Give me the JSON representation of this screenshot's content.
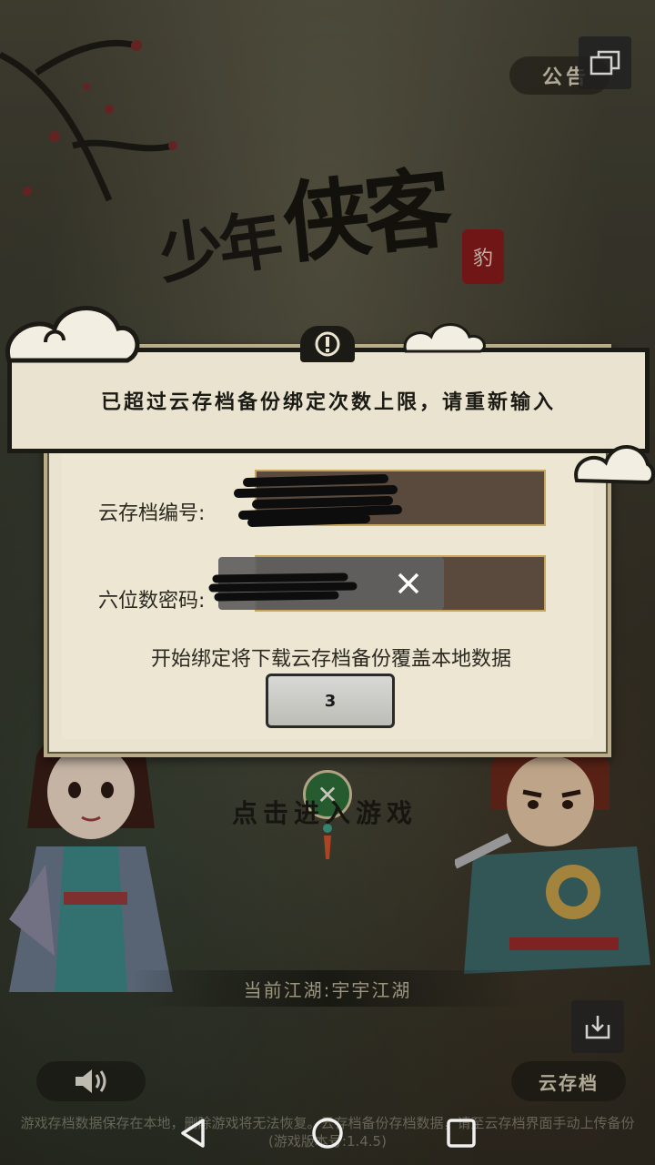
{
  "header": {
    "announce_label": "公告",
    "title_small": "少年",
    "title_big": "侠客",
    "seal_text": "豹"
  },
  "banner": {
    "message": "已超过云存档备份绑定次数上限，请重新输入"
  },
  "dialog": {
    "field1_label": "云存档编号:",
    "field2_label": "六位数密码:",
    "hint": "开始绑定将下载云存档备份覆盖本地数据",
    "confirm_label": "3"
  },
  "main": {
    "enter_text": "点击进入游戏",
    "world_label": "当前江湖:宇宇江湖",
    "cloud_save_label": "云存档",
    "footer_note": "游戏存档数据保存在本地，删除游戏将无法恢复。云存档备份存档数据，请至云存档界面手动上传备份(游戏版本号:1.4.5)"
  },
  "colors": {
    "banner_bg": "#e9e3cf",
    "field_bg": "#5a4a3e",
    "field_border": "#c9a55a",
    "jade": "#2f6e3a"
  },
  "icons": [
    "window-icon",
    "warning-icon",
    "close-icon",
    "sound-icon",
    "export-icon",
    "back-icon",
    "home-icon",
    "recents-icon"
  ]
}
